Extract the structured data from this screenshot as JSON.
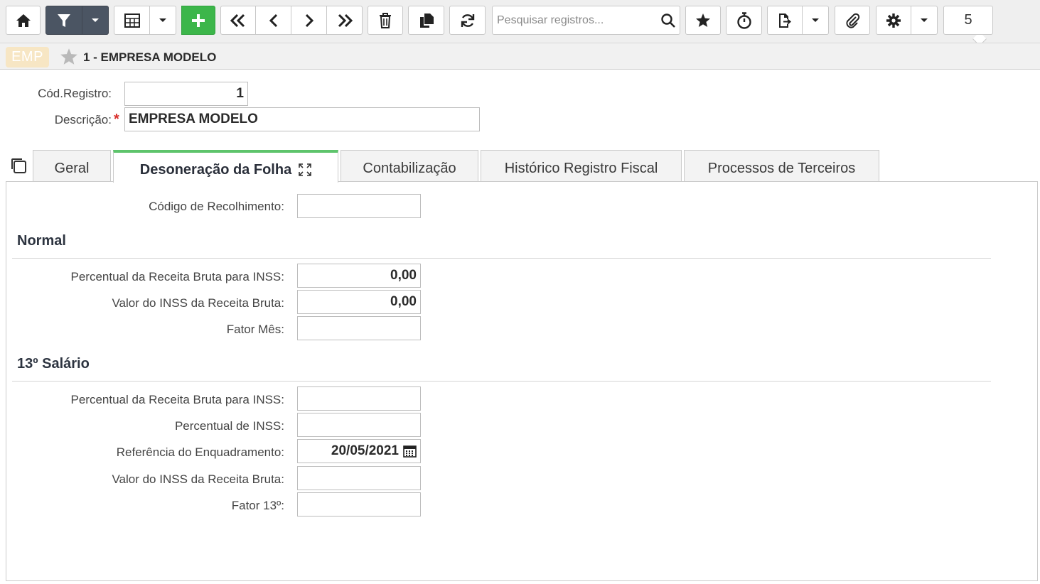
{
  "toolbar": {
    "search_placeholder": "Pesquisar registros...",
    "record_count": "5",
    "icons": [
      "home-icon",
      "filter-icon",
      "caret-down-icon",
      "grid-icon",
      "caret-down-icon",
      "plus-icon",
      "first-icon",
      "prev-icon",
      "next-icon",
      "last-icon",
      "trash-icon",
      "copy-icon",
      "refresh-icon",
      "search-icon",
      "star-icon",
      "timer-icon",
      "export-icon",
      "caret-down-icon",
      "paperclip-icon",
      "gear-icon",
      "caret-down-icon"
    ]
  },
  "record": {
    "badge": "EMP",
    "title": "1 - EMPRESA MODELO"
  },
  "header_fields": {
    "cod_label": "Cód.Registro:",
    "cod_value": "1",
    "desc_label": "Descrição:",
    "desc_required": "*",
    "desc_value": "EMPRESA MODELO"
  },
  "tabs": [
    {
      "label": "Geral"
    },
    {
      "label": "Desoneração da Folha"
    },
    {
      "label": "Contabilização"
    },
    {
      "label": "Histórico Registro Fiscal"
    },
    {
      "label": "Processos de Terceiros"
    }
  ],
  "panel": {
    "codigo_label": "Código de Recolhimento:",
    "codigo_value": "",
    "normal": {
      "title": "Normal",
      "fields": [
        {
          "label": "Percentual da Receita Bruta para INSS:",
          "value": "0,00"
        },
        {
          "label": "Valor do INSS da Receita Bruta:",
          "value": "0,00"
        },
        {
          "label": "Fator Mês:",
          "value": ""
        }
      ]
    },
    "decimo": {
      "title": "13º Salário",
      "fields": [
        {
          "label": "Percentual da Receita Bruta para INSS:",
          "value": ""
        },
        {
          "label": "Percentual de INSS:",
          "value": ""
        },
        {
          "label": "Referência do Enquadramento:",
          "value": "20/05/2021"
        },
        {
          "label": "Valor do INSS da Receita Bruta:",
          "value": ""
        },
        {
          "label": "Fator 13º:",
          "value": ""
        }
      ]
    }
  },
  "colors": {
    "accent_green": "#3cb64a",
    "active_tab_border": "#5ec46c",
    "dark_button": "#4b5563",
    "badge_bg": "#f7e6c4",
    "required": "#d9302c"
  }
}
